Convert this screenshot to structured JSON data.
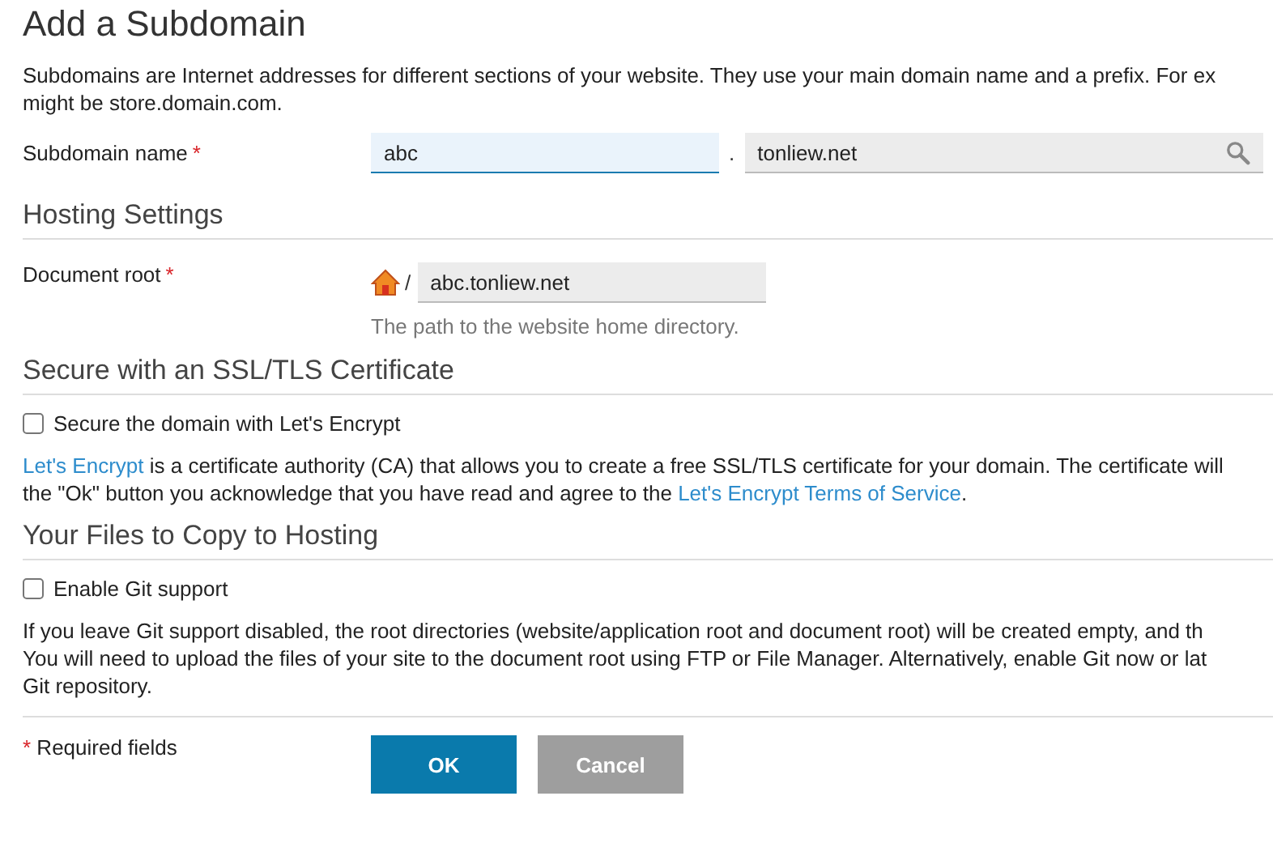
{
  "title": "Add a Subdomain",
  "intro": [
    "Subdomains are Internet addresses for different sections of your website. They use your main domain name and a prefix. For ex",
    "might be store.domain.com."
  ],
  "subdomain": {
    "label": "Subdomain name",
    "required": true,
    "value": "abc",
    "separator": ".",
    "domain": "tonliew.net"
  },
  "hosting": {
    "heading": "Hosting Settings",
    "label": "Document root",
    "required": true,
    "separator": "/",
    "value": "abc.tonliew.net",
    "hint": "The path to the website home directory."
  },
  "ssl": {
    "heading": "Secure with an SSL/TLS Certificate",
    "checkbox": {
      "label": "Secure the domain with Let's Encrypt",
      "checked": false
    },
    "lines": [
      [
        {
          "text": "Let's Encrypt",
          "link": true
        },
        {
          "text": " is a certificate authority (CA) that allows you to create a free SSL/TLS certificate for your domain. The certificate will",
          "link": false
        }
      ],
      [
        {
          "text": "the \"Ok\" button you acknowledge that you have read and agree to the ",
          "link": false
        },
        {
          "text": "Let's Encrypt Terms of Service",
          "link": true
        },
        {
          "text": ".",
          "link": false
        }
      ]
    ]
  },
  "files": {
    "heading": "Your Files to Copy to Hosting",
    "checkbox": {
      "label": "Enable Git support",
      "checked": false
    },
    "lines": [
      "If you leave Git support disabled, the root directories (website/application root and document root) will be created empty, and th",
      "You will need to upload the files of your site to the document root using FTP or File Manager. Alternatively, enable Git now or lat",
      "Git repository."
    ]
  },
  "footer": {
    "required_mark": "*",
    "required_text": "Required fields",
    "buttons": [
      {
        "label": "OK",
        "kind": "primary"
      },
      {
        "label": "Cancel",
        "kind": "secondary"
      }
    ]
  }
}
